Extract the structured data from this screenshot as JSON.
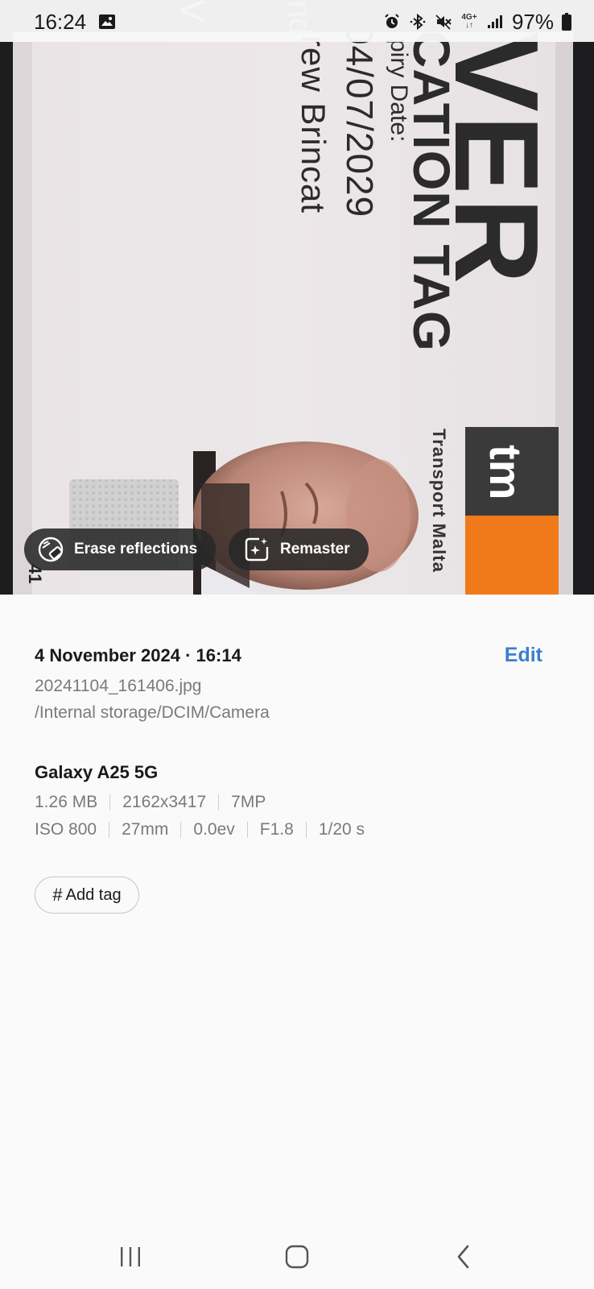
{
  "status_bar": {
    "time": "16:24",
    "network": "4G+",
    "battery": "97%",
    "icons": [
      "gallery-notification-icon",
      "alarm-icon",
      "bluetooth-icon",
      "mute-icon",
      "network-4g-icon",
      "signal-icon",
      "battery-icon"
    ]
  },
  "photo": {
    "card_title_large": "VER",
    "card_title_line2": "CATION TAG",
    "expiry_label": "piry Date:",
    "expiry_date": "04/07/2029",
    "holder_name": "rew Brincat",
    "brand_logo": "tm",
    "brand_name": "Transport Malta",
    "card_number_fragment": "41",
    "faint_text_1": "V",
    "faint_text_2": "nd",
    "colors": {
      "brand_orange": "#f07a1a",
      "brand_dark": "#3a3a3a"
    }
  },
  "actions": {
    "erase_label": "Erase reflections",
    "remaster_label": "Remaster"
  },
  "details": {
    "date_time": "4 November 2024 · 16:14",
    "edit_label": "Edit",
    "file_name": "20241104_161406.jpg",
    "path": "/Internal storage/DCIM/Camera",
    "device": "Galaxy A25 5G",
    "specs_row1": [
      "1.26 MB",
      "2162x3417",
      "7MP"
    ],
    "specs_row2": [
      "ISO 800",
      "27mm",
      "0.0ev",
      "F1.8",
      "1/20 s"
    ],
    "add_tag_label": "Add tag",
    "colors": {
      "accent": "#3b7fcc"
    }
  },
  "nav": {
    "recents": "recents-icon",
    "home": "home-icon",
    "back": "back-icon"
  }
}
